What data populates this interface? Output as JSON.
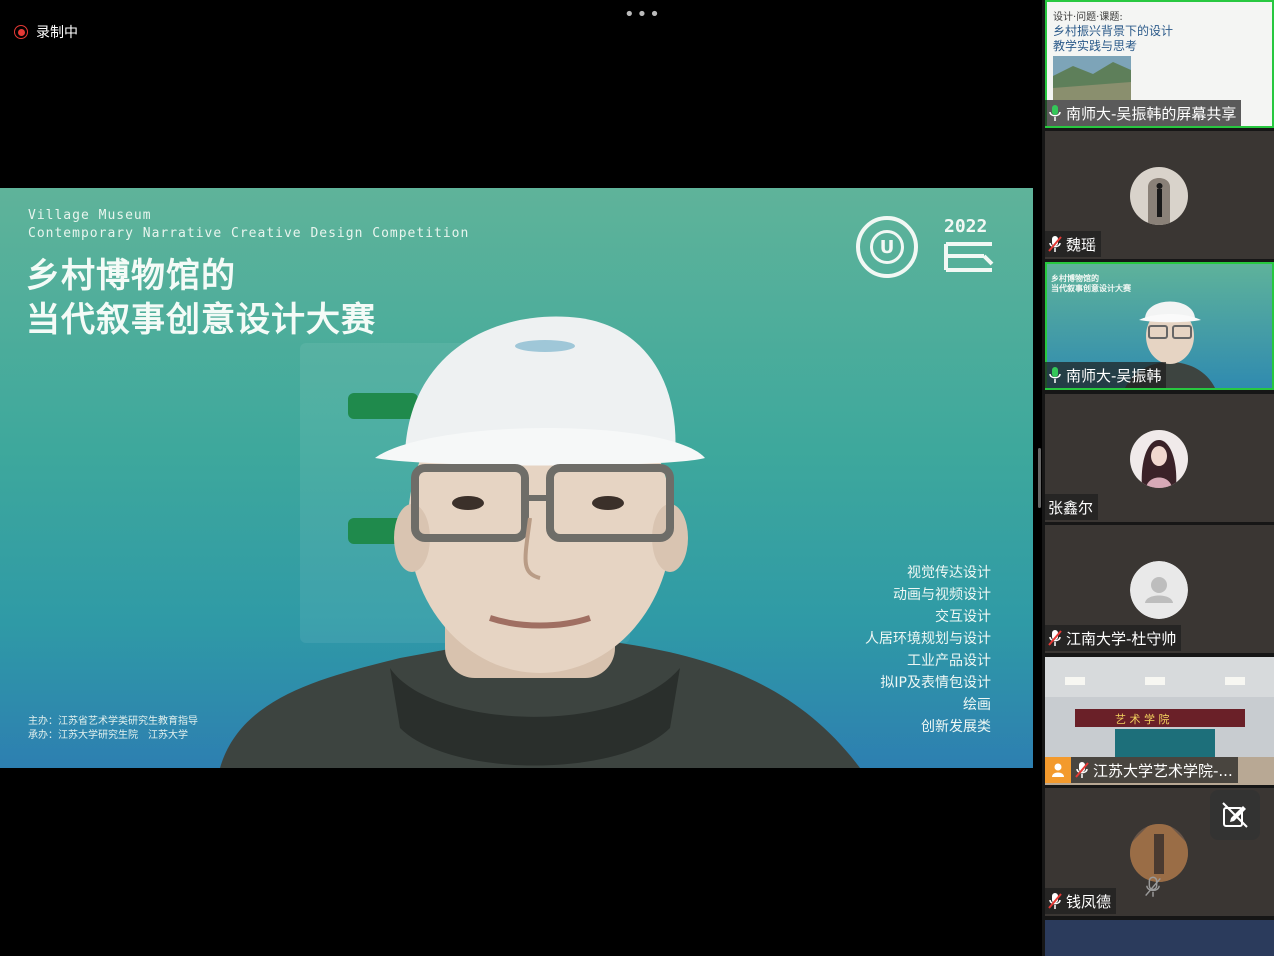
{
  "recording": {
    "label": "录制中"
  },
  "menu": {
    "more_icon": "•••"
  },
  "slide": {
    "en_line1": "Village Museum",
    "en_line2": "Contemporary Narrative  Creative Design Competition",
    "title_line1": "乡村博物馆的",
    "title_line2": "当代叙事创意设计大赛",
    "year": "2022",
    "categories": [
      "视觉传达设计",
      "动画与视频设计",
      "交互设计",
      "人居环境规划与设计",
      "工业产品设计",
      "拟IP及表情包设计",
      "绘画",
      "创新发展类"
    ],
    "organizer_line1": "主办：江苏省艺术学类研究生教育指导",
    "organizer_line2": "承办：江苏大学研究生院　江苏大学"
  },
  "participants": [
    {
      "name": "南师大-吴振韩的屏幕共享",
      "mic": "on",
      "type": "screen",
      "preview_line0": "设计·问题·课题:",
      "preview_line1": "乡村振兴背景下的设计",
      "preview_line2": "教学实践与思考"
    },
    {
      "name": "魏瑶",
      "mic": "muted",
      "type": "avatar"
    },
    {
      "name": "南师大-吴振韩",
      "mic": "on",
      "type": "video",
      "preview_title": "乡村博物馆的\n当代叙事创意设计大赛"
    },
    {
      "name": "张鑫尔",
      "mic": "none",
      "type": "avatar"
    },
    {
      "name": "江南大学-杜守帅",
      "mic": "muted",
      "type": "default-avatar"
    },
    {
      "name": "江苏大学艺术学院-...",
      "mic": "muted",
      "type": "room",
      "room_banner": "艺 术 学 院"
    },
    {
      "name": "钱凤德",
      "mic": "muted",
      "type": "avatar"
    }
  ],
  "colors": {
    "active_border": "#28c840",
    "record_red": "#e53935",
    "mic_green": "#34c759"
  }
}
